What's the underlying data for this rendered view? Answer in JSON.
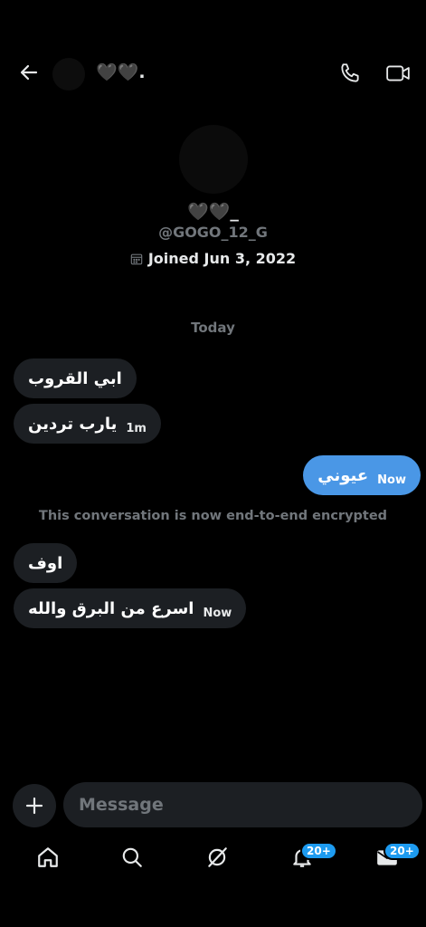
{
  "header": {
    "name": "🖤🖤.",
    "back_icon": "arrow-left-icon",
    "call_icon": "phone-icon",
    "video_icon": "video-camera-icon"
  },
  "profile": {
    "name": "🖤🖤_",
    "handle": "@GOGO_12_G",
    "joined": "Joined Jun 3, 2022"
  },
  "conversation": {
    "date_divider": "Today",
    "encryption_notice": "This conversation is now end-to-end encrypted",
    "messages": [
      {
        "side": "received",
        "text": "ابي القروب",
        "time": ""
      },
      {
        "side": "received",
        "text": "يارب تردين",
        "time": "1m"
      },
      {
        "side": "sent",
        "text": "عيوني",
        "time": "Now"
      },
      {
        "side": "received",
        "text": "اوف",
        "time": ""
      },
      {
        "side": "received",
        "text": "اسرع من البرق والله",
        "time": "Now"
      }
    ]
  },
  "composer": {
    "placeholder": "Message"
  },
  "nav": {
    "notifications_badge": "20+",
    "messages_badge": "20+"
  },
  "colors": {
    "background": "#000000",
    "received_bubble": "#1c1f23",
    "sent_bubble": "#4a97e6",
    "muted_text": "#71767b",
    "badge": "#1d9bf0"
  }
}
